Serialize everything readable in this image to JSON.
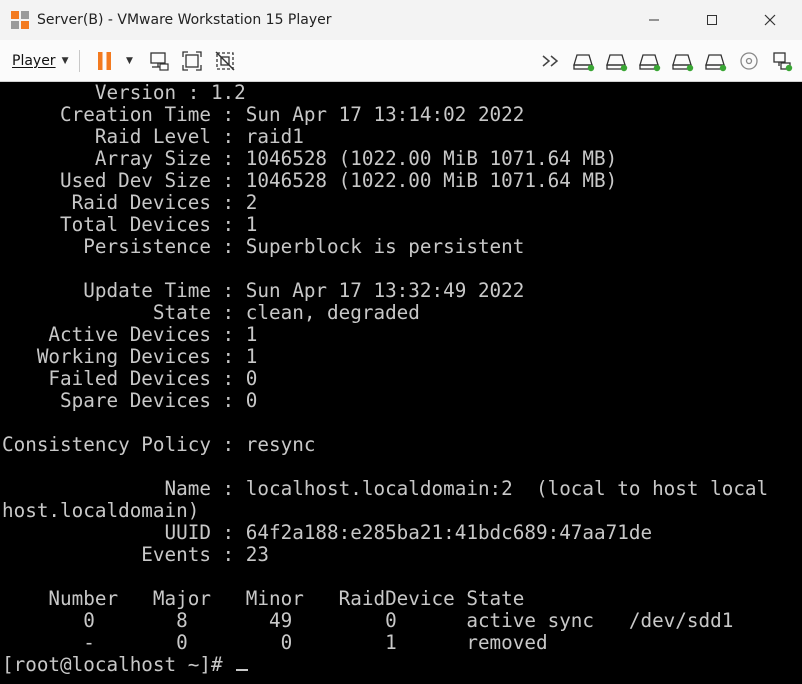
{
  "window": {
    "title": "Server(B) - VMware Workstation 15 Player",
    "controls": {
      "minimize": "—",
      "maximize": "☐",
      "close": "✕"
    }
  },
  "toolbar": {
    "player_label": "Player",
    "left_icons": [
      "pause-icon",
      "send-ctrl-alt-del-icon",
      "fit-guest-icon",
      "unity-icon"
    ],
    "right_icons": [
      "more-icon",
      "hdd-icon",
      "hdd-icon",
      "hdd-icon",
      "hdd-icon",
      "hdd-icon",
      "cd-icon",
      "network-icon"
    ],
    "accent": "#f37a1f",
    "device_active": "#3aa635"
  },
  "console": {
    "lines": [
      "        Version : 1.2",
      "     Creation Time : Sun Apr 17 13:14:02 2022",
      "        Raid Level : raid1",
      "        Array Size : 1046528 (1022.00 MiB 1071.64 MB)",
      "     Used Dev Size : 1046528 (1022.00 MiB 1071.64 MB)",
      "      Raid Devices : 2",
      "     Total Devices : 1",
      "       Persistence : Superblock is persistent",
      "",
      "       Update Time : Sun Apr 17 13:32:49 2022",
      "             State : clean, degraded",
      "    Active Devices : 1",
      "   Working Devices : 1",
      "    Failed Devices : 0",
      "     Spare Devices : 0",
      "",
      "Consistency Policy : resync",
      "",
      "              Name : localhost.localdomain:2  (local to host local",
      "host.localdomain)",
      "              UUID : 64f2a188:e285ba21:41bdc689:47aa71de",
      "            Events : 23",
      "",
      "    Number   Major   Minor   RaidDevice State",
      "       0       8       49        0      active sync   /dev/sdd1",
      "       -       0        0        1      removed",
      "[root@localhost ~]# "
    ]
  }
}
